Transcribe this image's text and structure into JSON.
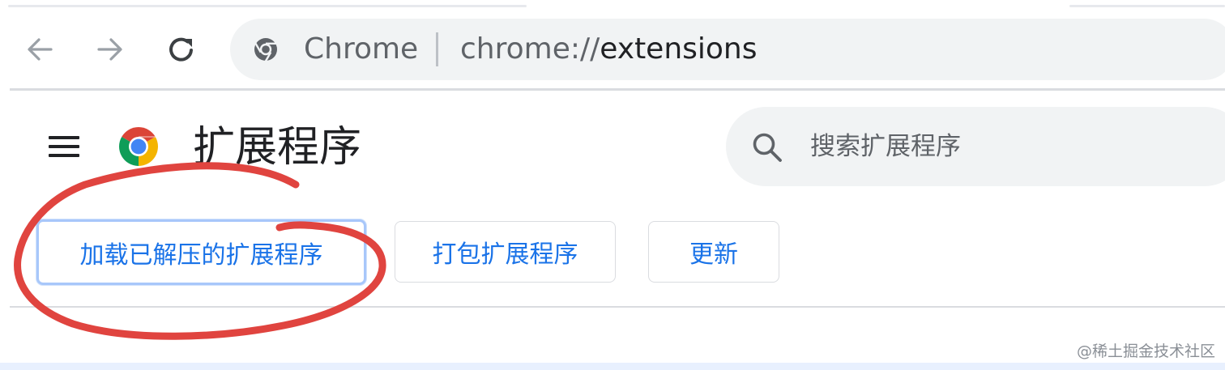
{
  "browser": {
    "back_icon": "arrow-left-icon",
    "forward_icon": "arrow-right-icon",
    "reload_icon": "reload-icon",
    "omnibox": {
      "site_chip_icon": "chrome-icon",
      "site_chip_label": "Chrome",
      "url_scheme": "chrome://",
      "url_host": "extensions"
    }
  },
  "header": {
    "menu_icon": "hamburger-menu-icon",
    "logo_icon": "chrome-logo-icon",
    "title": "扩展程序",
    "search": {
      "icon": "search-icon",
      "placeholder": "搜索扩展程序",
      "value": ""
    }
  },
  "toolbar": {
    "load_unpacked_label": "加载已解压的扩展程序",
    "pack_label": "打包扩展程序",
    "update_label": "更新"
  },
  "annotation": {
    "type": "red hand-drawn circle around load unpacked button",
    "color": "#e0443f"
  },
  "colors": {
    "accent": "#1a73e8",
    "text": "#202124",
    "secondary_text": "#5f6368",
    "surface": "#f1f3f4",
    "divider": "#dadce0"
  },
  "watermark": "@稀土掘金技术社区"
}
